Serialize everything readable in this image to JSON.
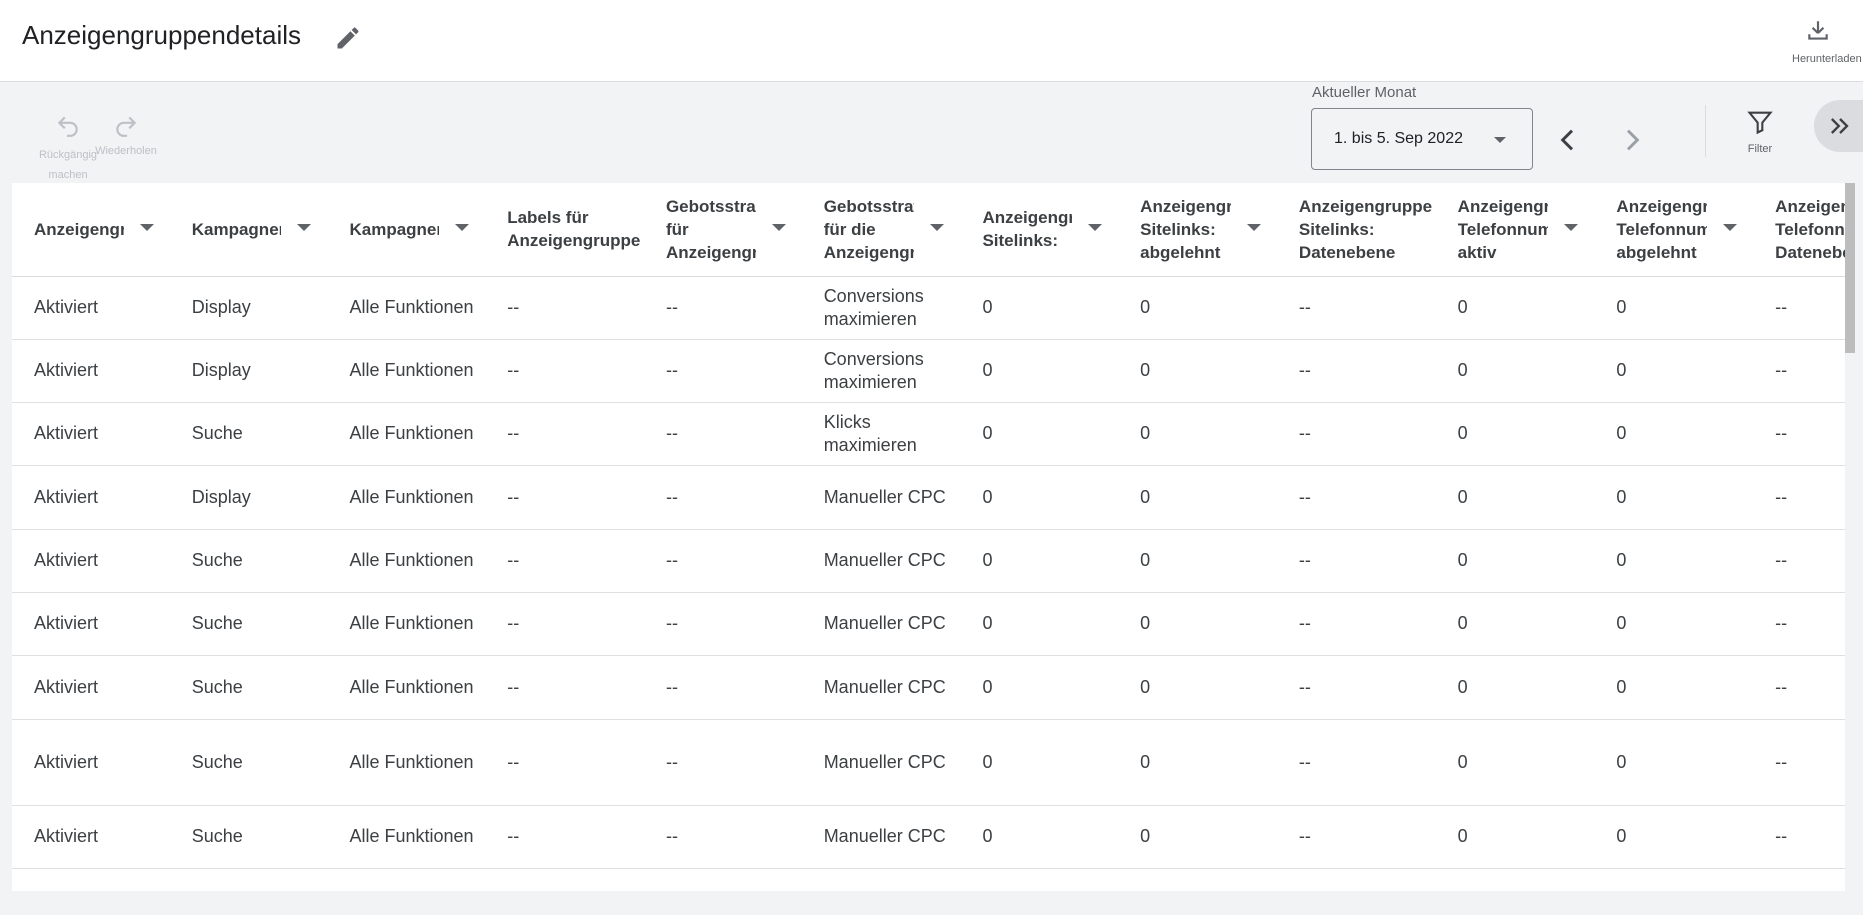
{
  "header": {
    "title": "Anzeigengruppendetails",
    "download_label": "Herunterladen"
  },
  "toolbar": {
    "undo_label": "Rückgängig machen",
    "redo_label": "Wiederholen",
    "date_range_label": "Aktueller Monat",
    "date_range_value": "1. bis 5. Sep 2022",
    "filter_label": "Filter"
  },
  "table": {
    "columns": [
      "Anzeigengruppenstatus",
      "Kampagnentyp",
      "Kampagnenuntertyp",
      "Labels für Anzeigengruppe",
      "Gebotsstrategie für Anzeigengruppe",
      "Gebotsstrategie für die Anzeigengruppe",
      "Anzeigengruppe Sitelinks: aktiv",
      "Anzeigengruppe Sitelinks: abgelehnt",
      "Anzeigengruppe Sitelinks: Datenebene",
      "Anzeigengruppe Telefonnummer aktiv",
      "Anzeigengruppe Telefonnummer abgelehnt",
      "Anzeigengruppe Telefonnummer Datenebene"
    ],
    "rows": [
      [
        "Aktiviert",
        "Display",
        "Alle Funktionen",
        "--",
        "--",
        "Conversions maximieren",
        "0",
        "0",
        "--",
        "0",
        "0",
        "--"
      ],
      [
        "Aktiviert",
        "Display",
        "Alle Funktionen",
        "--",
        "--",
        "Conversions maximieren",
        "0",
        "0",
        "--",
        "0",
        "0",
        "--"
      ],
      [
        "Aktiviert",
        "Suche",
        "Alle Funktionen",
        "--",
        "--",
        "Klicks maximieren",
        "0",
        "0",
        "--",
        "0",
        "0",
        "--"
      ],
      [
        "Aktiviert",
        "Display",
        "Alle Funktionen",
        "--",
        "--",
        "Manueller CPC",
        "0",
        "0",
        "--",
        "0",
        "0",
        "--"
      ],
      [
        "Aktiviert",
        "Suche",
        "Alle Funktionen",
        "--",
        "--",
        "Manueller CPC",
        "0",
        "0",
        "--",
        "0",
        "0",
        "--"
      ],
      [
        "Aktiviert",
        "Suche",
        "Alle Funktionen",
        "--",
        "--",
        "Manueller CPC",
        "0",
        "0",
        "--",
        "0",
        "0",
        "--"
      ],
      [
        "Aktiviert",
        "Suche",
        "Alle Funktionen",
        "--",
        "--",
        "Manueller CPC",
        "0",
        "0",
        "--",
        "0",
        "0",
        "--"
      ],
      [
        "Aktiviert",
        "Suche",
        "Alle Funktionen",
        "--",
        "--",
        "Manueller CPC",
        "0",
        "0",
        "--",
        "0",
        "0",
        "--"
      ],
      [
        "Aktiviert",
        "Suche",
        "Alle Funktionen",
        "--",
        "--",
        "Manueller CPC",
        "0",
        "0",
        "--",
        "0",
        "0",
        "--"
      ]
    ]
  }
}
